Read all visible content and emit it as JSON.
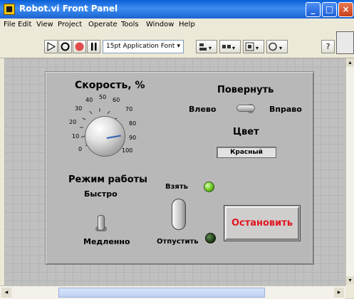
{
  "window": {
    "title": "Robot.vi Front Panel"
  },
  "menu": [
    "File",
    "Edit",
    "View",
    "Project",
    "Operate",
    "Tools",
    "Window",
    "Help"
  ],
  "toolbar": {
    "font": "15pt Application Font",
    "help": "?"
  },
  "speed": {
    "label": "Скорость, %",
    "ticks": [
      "0",
      "10",
      "20",
      "30",
      "40",
      "50",
      "60",
      "70",
      "80",
      "90",
      "100"
    ],
    "value": 85
  },
  "turn": {
    "label": "Повернуть",
    "left": "Влево",
    "right": "Вправо"
  },
  "color": {
    "label": "Цвет",
    "value": "Красный"
  },
  "mode": {
    "label": "Режим работы",
    "fast": "Быстро",
    "slow": "Медленно"
  },
  "grip": {
    "take": "Взять",
    "release": "Отпустить"
  },
  "stop": {
    "label": "Остановить"
  },
  "colors": {
    "titlebar": "#0a5fd8",
    "panel": "#b8b8b8",
    "stop_text": "#e2151f",
    "led_on": "#69c41e"
  }
}
